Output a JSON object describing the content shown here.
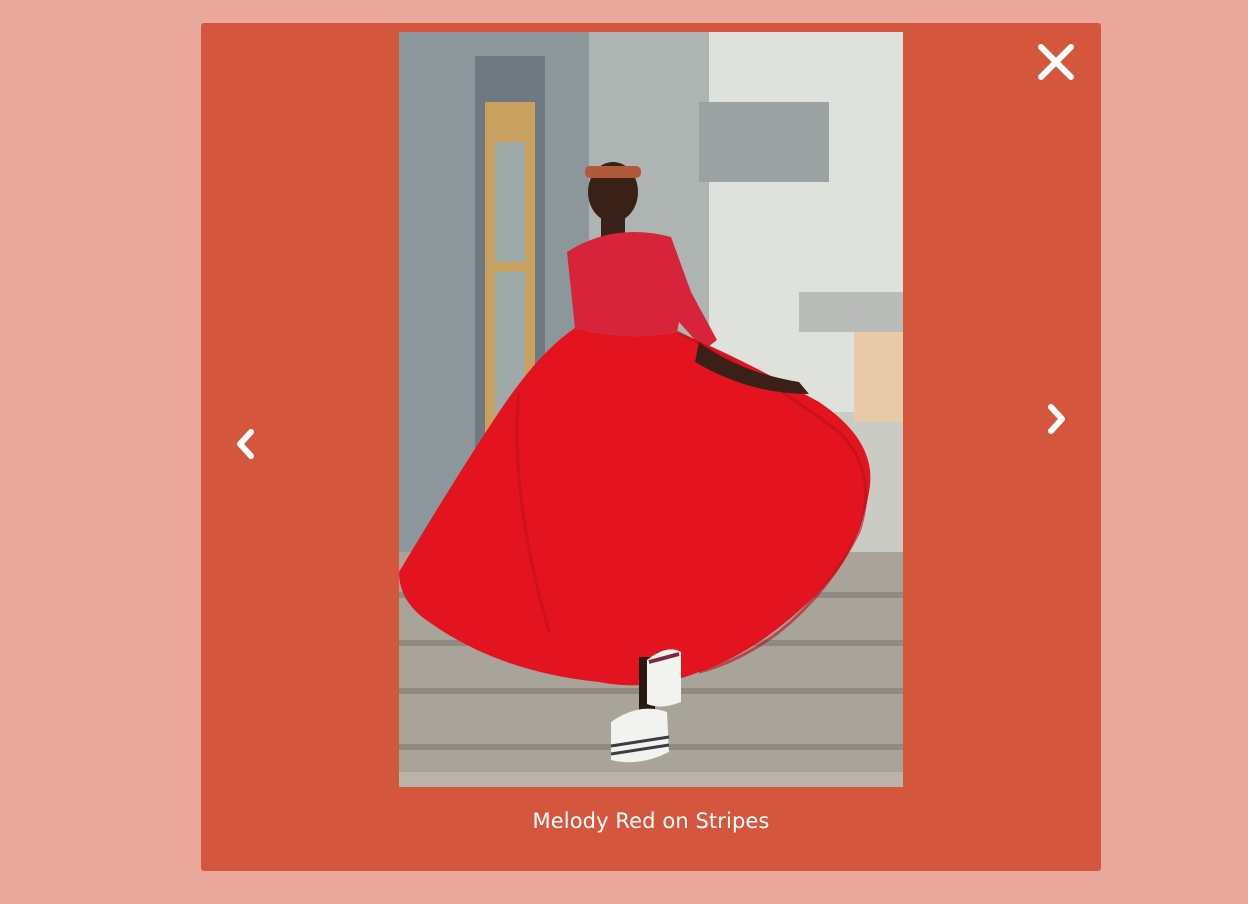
{
  "lightbox": {
    "caption": "Melody Red on Stripes",
    "close_icon": "close-icon",
    "prev_icon": "chevron-left-icon",
    "next_icon": "chevron-right-icon",
    "photo_subject": "woman-in-red-dress-photo"
  },
  "colors": {
    "page_background": "#e8a89b",
    "modal_background": "#d4563c",
    "icon_color": "#ffffff",
    "caption_color": "#ffffff"
  }
}
